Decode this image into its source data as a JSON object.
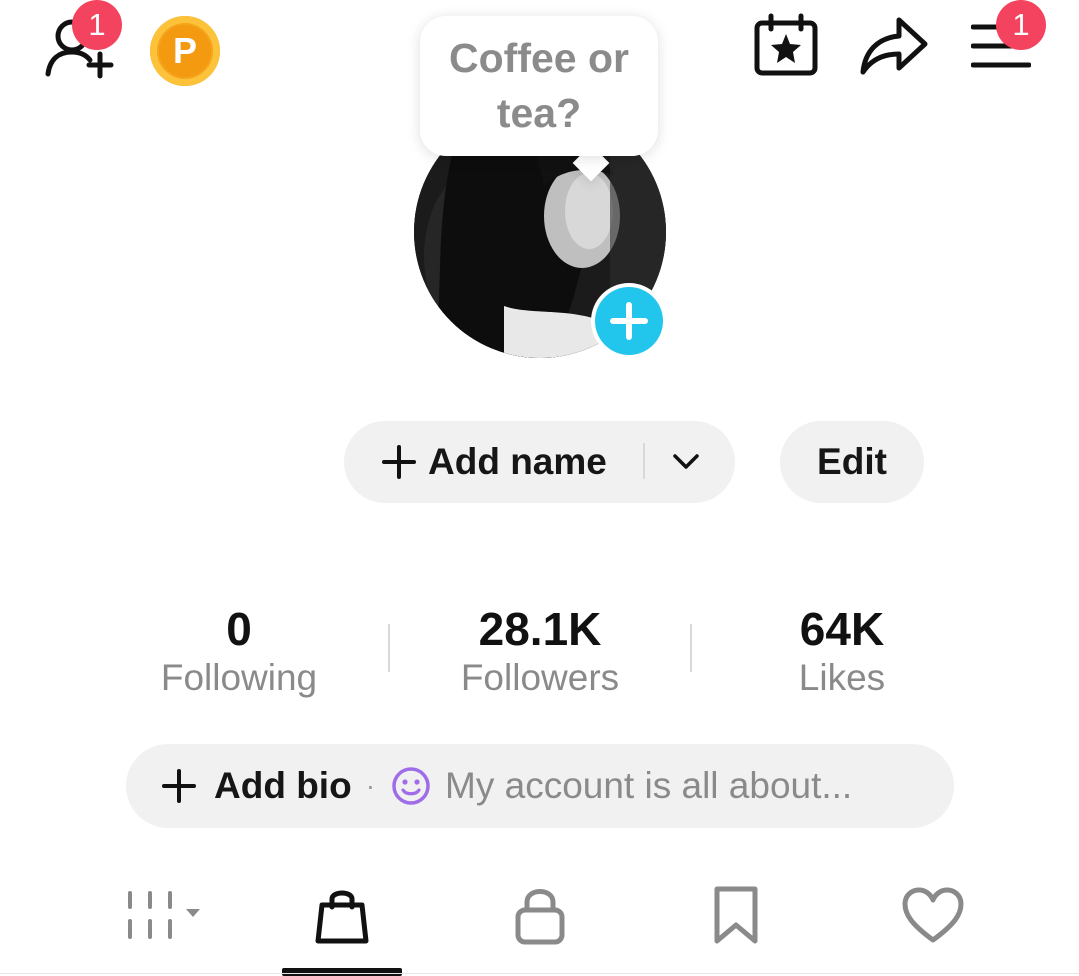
{
  "top_bar": {
    "add_friend_badge": "1",
    "coin_letter": "P",
    "menu_badge": "1",
    "icons": [
      "add-friend-icon",
      "coin-icon",
      "calendar-star-icon",
      "share-arrow-icon",
      "menu-icon"
    ]
  },
  "bubble": {
    "line1": "Coffee or",
    "line2": "tea?"
  },
  "profile": {
    "add_name_label": "Add name",
    "edit_label": "Edit"
  },
  "stats": [
    {
      "value": "0",
      "label": "Following"
    },
    {
      "value": "28.1K",
      "label": "Followers"
    },
    {
      "value": "64K",
      "label": "Likes"
    }
  ],
  "bio": {
    "add_label": "Add bio",
    "separator": "·",
    "placeholder": "My account is all about..."
  },
  "tabs": [
    {
      "name": "grid-icon",
      "active": false
    },
    {
      "name": "shopping-bag-icon",
      "active": true
    },
    {
      "name": "lock-icon",
      "active": false
    },
    {
      "name": "bookmark-icon",
      "active": false
    },
    {
      "name": "heart-icon",
      "active": false
    }
  ],
  "colors": {
    "badge": "#f3435e",
    "accent_blue": "#22c6ec",
    "pill_bg": "#f1f1f2",
    "muted_text": "#8a8a8a",
    "emoji_purple": "#a06de8"
  }
}
